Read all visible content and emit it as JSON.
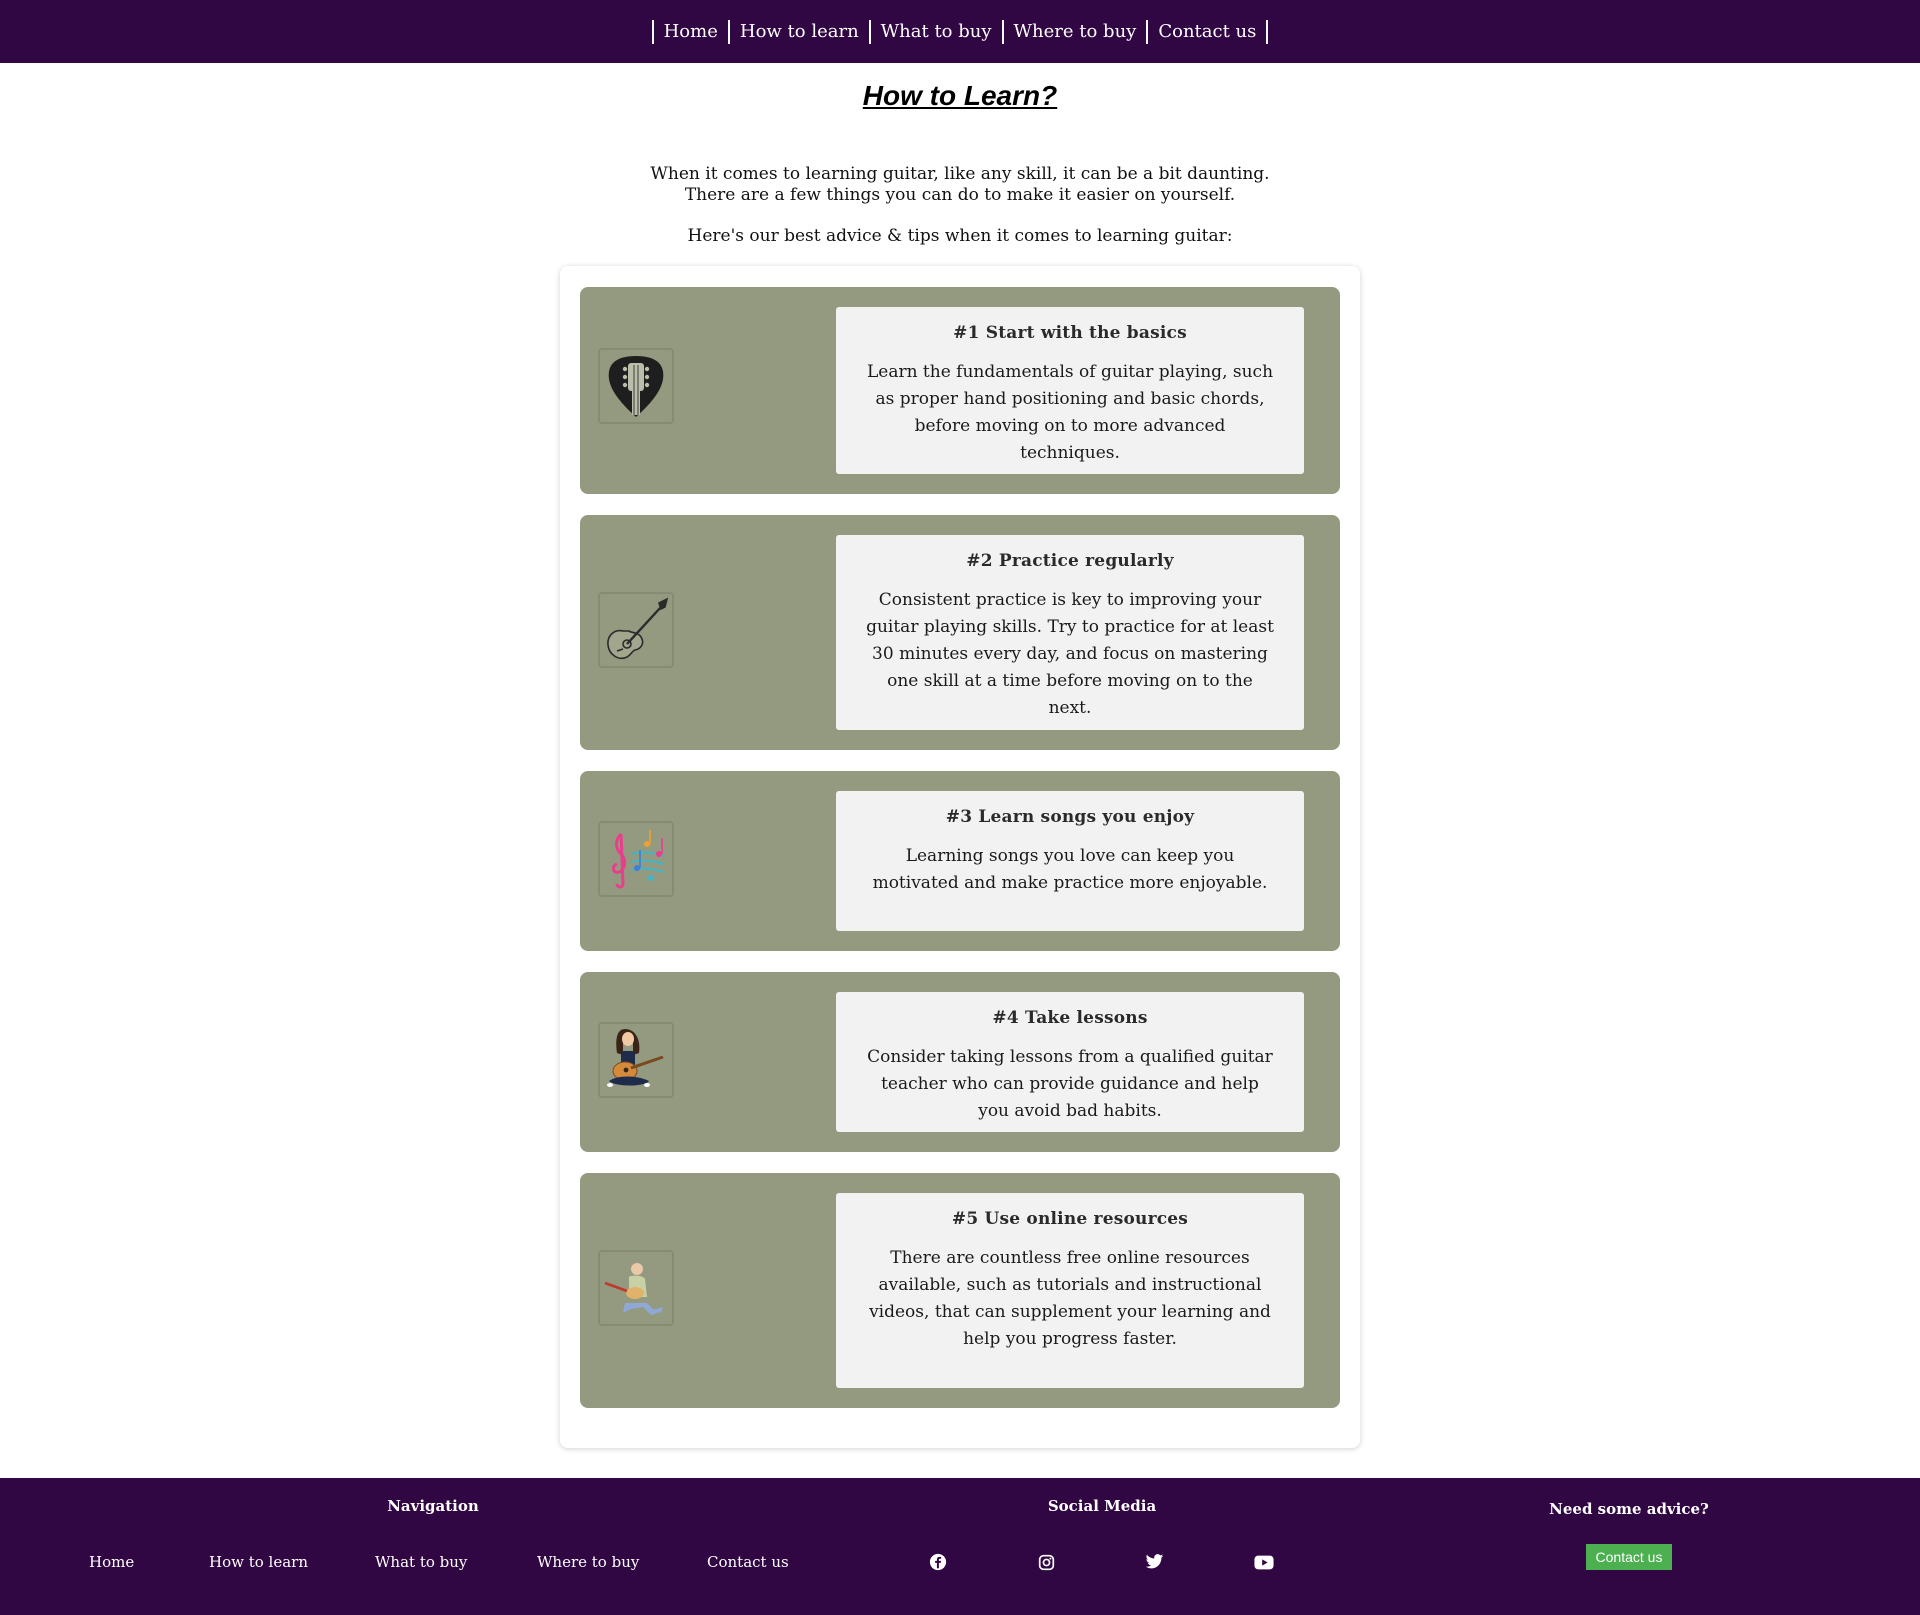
{
  "nav": {
    "items": [
      "Home",
      "How to learn",
      "What to buy",
      "Where to buy",
      "Contact us"
    ]
  },
  "page": {
    "title": "How to Learn?",
    "intro_line1": "When it comes to learning guitar, like any skill, it can be a bit daunting.",
    "intro_line2": "There are a few things you can do to make it easier on yourself.",
    "lead": "Here's our best advice & tips when it comes to learning guitar:"
  },
  "tips": [
    {
      "title": "#1 Start with the basics",
      "text": "Learn the fundamentals of guitar playing, such as proper hand positioning and basic chords, before moving on to more advanced techniques.",
      "icon": "guitar-pick-headstock-icon"
    },
    {
      "title": "#2 Practice regularly",
      "text": "Consistent practice is key to improving your guitar playing skills. Try to practice for at least 30 minutes every day, and focus on mastering one skill at a time before moving on to the next.",
      "icon": "acoustic-guitar-icon"
    },
    {
      "title": "#3 Learn songs you enjoy",
      "text": "Learning songs you love can keep you motivated and make practice more enjoyable.",
      "icon": "music-notes-icon"
    },
    {
      "title": "#4 Take lessons",
      "text": "Consider taking lessons from a qualified guitar teacher who can provide guidance and help you avoid bad habits.",
      "icon": "guitarist-girl-icon"
    },
    {
      "title": "#5 Use online resources",
      "text": "There are countless free online resources available, such as tutorials and instructional videos, that can supplement your learning and help you progress faster.",
      "icon": "guitarist-playing-icon"
    }
  ],
  "footer": {
    "nav_heading": "Navigation",
    "nav_items": [
      "Home",
      "How to learn",
      "What to buy",
      "Where to buy",
      "Contact us"
    ],
    "social_heading": "Social Media",
    "social_icons": [
      "facebook-icon",
      "instagram-icon",
      "twitter-icon",
      "youtube-icon"
    ],
    "advice_heading": "Need some advice?",
    "advice_button": "Contact us"
  },
  "colors": {
    "brand_purple": "#300643",
    "tip_background": "#939a80",
    "tip_panel": "#f2f2f2",
    "button_green": "#4caf50"
  }
}
